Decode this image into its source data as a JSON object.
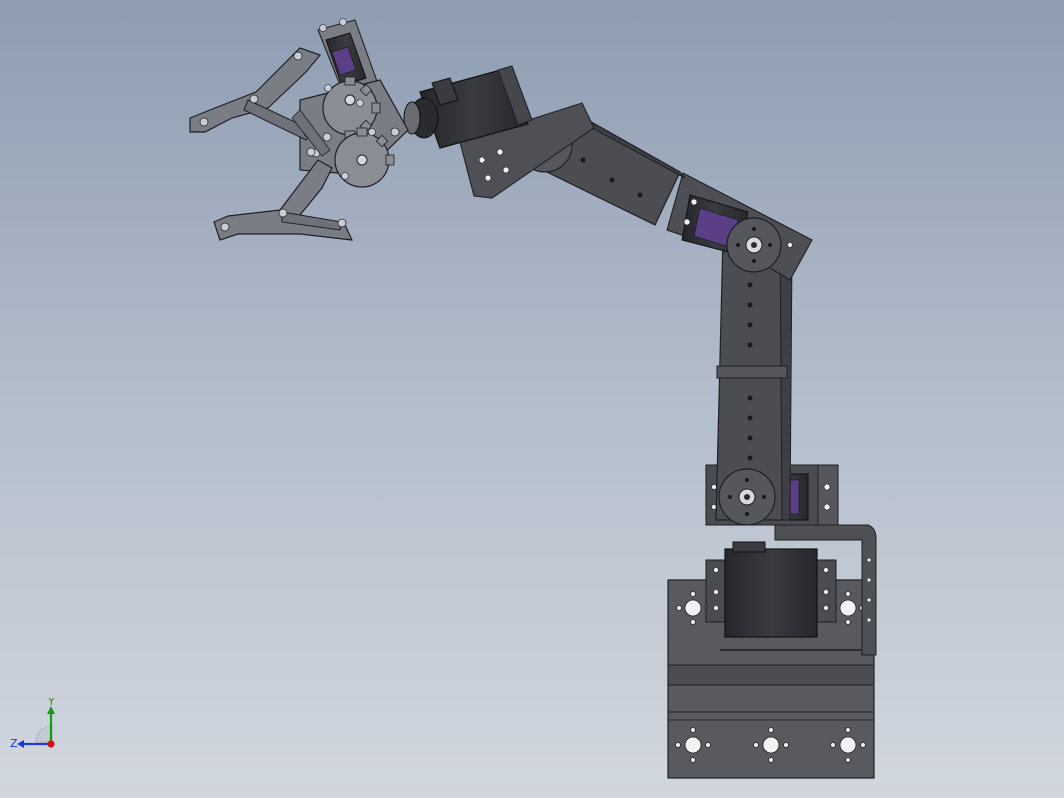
{
  "viewport": {
    "model": "robot-arm-assembly",
    "background_top": "#8e9db2",
    "background_bottom": "#d2d7df"
  },
  "colors": {
    "metal": "#5f6166",
    "metal_dark": "#3e4045",
    "metal_light": "#8a8d93",
    "edge": "#1f2024",
    "servo_body": "#2e2f34",
    "servo_label": "#5a3f86",
    "gripper": "#7a7d84",
    "hole": "#f2f2f2",
    "screw": "#c9ccd2"
  },
  "triad": {
    "x_color": "#d01010",
    "y_color": "#12a012",
    "z_color": "#1a3ad0",
    "y_label": "Y",
    "z_label": "Z"
  }
}
